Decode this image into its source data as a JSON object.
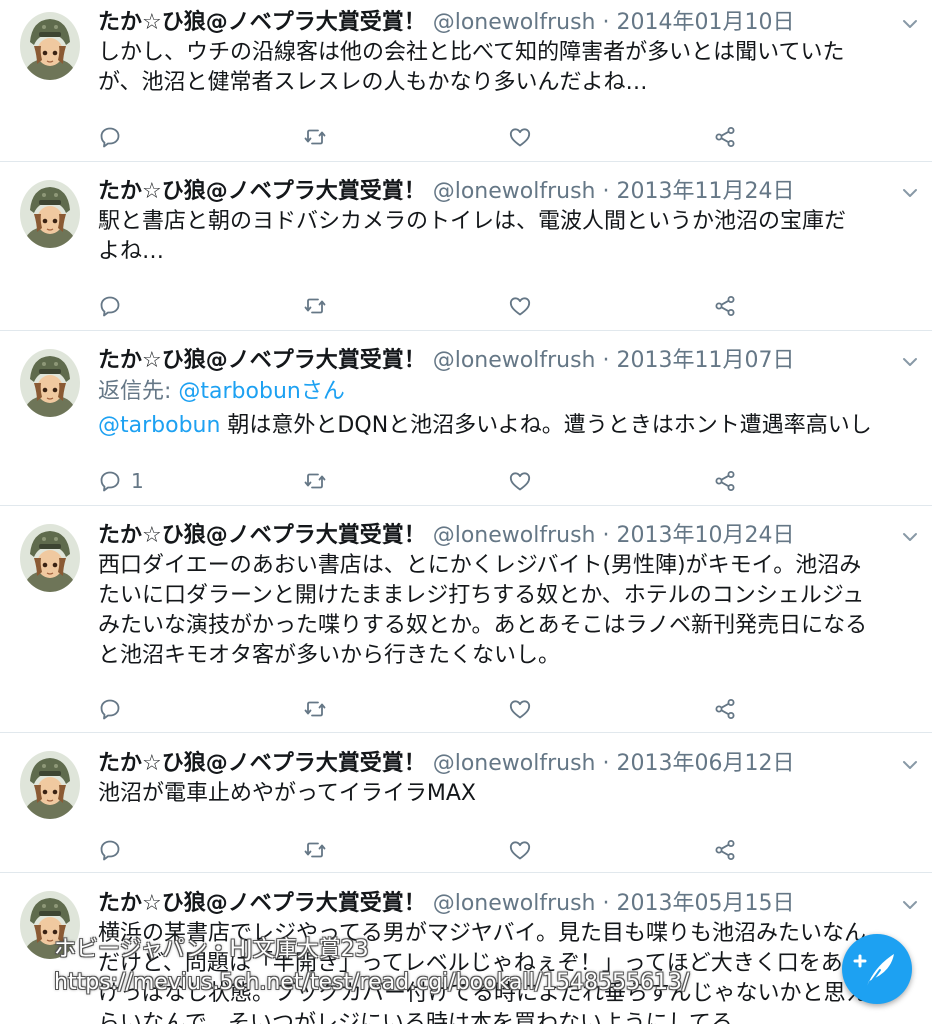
{
  "author": {
    "name": "たか☆ひ狼@ノベプラ大賞受賞！",
    "handle": "@lonewolfrush",
    "separator": "·"
  },
  "tweets": [
    {
      "date": "2014年01月10日",
      "text_lines": [
        "しかし、ウチの沿線客は他の会社と比べて知的障害者が多いとは聞いていた",
        "が、池沼と健常者スレスレの人もかなり多いんだよね…"
      ],
      "reply_count": ""
    },
    {
      "date": "2013年11月24日",
      "text_lines": [
        "駅と書店と朝のヨドバシカメラのトイレは、電波人間というか池沼の宝庫だ",
        "よね…"
      ],
      "reply_count": ""
    },
    {
      "date": "2013年11月07日",
      "reply_prefix": "返信先: ",
      "reply_link": "@tarbobunさん",
      "mention": "@tarbobun",
      "text_after_mention": " 朝は意外とDQNと池沼多いよね。遭うときはホント遭遇率高いし",
      "reply_count": "1"
    },
    {
      "date": "2013年10月24日",
      "text_lines": [
        "西口ダイエーのあおい書店は、とにかくレジバイト(男性陣)がキモイ。池沼み",
        "たいに口ダラーンと開けたままレジ打ちする奴とか、ホテルのコンシェルジュ",
        "みたいな演技がかった喋りする奴とか。あとあそこはラノベ新刊発売日になる",
        "と池沼キモオタ客が多いから行きたくないし。"
      ],
      "reply_count": ""
    },
    {
      "date": "2013年06月12日",
      "text_lines": [
        "池沼が電車止めやがってイライラMAX"
      ],
      "reply_count": ""
    },
    {
      "date": "2013年05月15日",
      "text_lines": [
        "横浜の某書店でレジやってる男がマジヤバイ。見た目も喋りも池沼みたいなん",
        "だけど、問題は「半開き」ってレベルじゃねぇぞ！」ってほど大きく口をあ",
        "けっぱなし状態。ブックカバー付けてる時によだれ垂らすんじゃないかと思え",
        "らいなんで、そいつがレジにいる時は本を買わないようにしてる"
      ],
      "reply_count": ""
    }
  ],
  "watermark": {
    "line1": "ホビージャパン・HJ文庫大賞23",
    "line2": "https://mevius.5ch.net/test/read.cgi/bookall/1548555613/"
  },
  "icons": {
    "avatar": "avatar-helmet-character",
    "menu": "chevron-down-icon",
    "reply": "reply-icon",
    "retweet": "retweet-icon",
    "like": "heart-icon",
    "share": "share-icon",
    "compose": "compose-tweet-icon"
  },
  "colors": {
    "accent": "#1da1f2",
    "text": "#14171a",
    "muted": "#657786",
    "divider": "#e1e8ed"
  }
}
